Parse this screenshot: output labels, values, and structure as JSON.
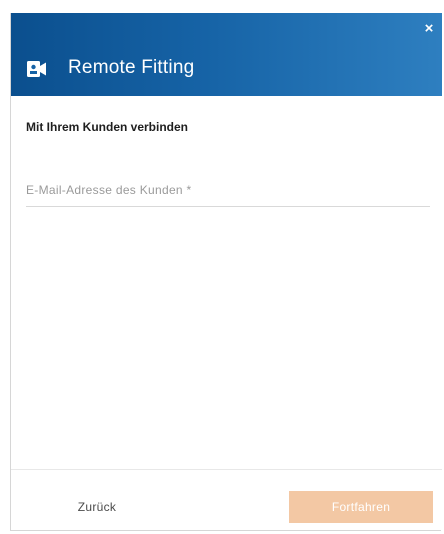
{
  "dialog": {
    "title": "Remote Fitting",
    "header_icon": "video-camera-icon",
    "close_icon": "close-icon",
    "close_glyph": "×",
    "subtitle": "Mit Ihrem Kunden verbinden",
    "email": {
      "placeholder": "E-Mail-Adresse des Kunden *",
      "value": ""
    },
    "back_label": "Zurück",
    "next_label": "Fortfahren",
    "colors": {
      "header_start": "#0b4f8e",
      "header_end": "#2e7fc0",
      "next_button_bg": "#f3c8a4"
    }
  }
}
